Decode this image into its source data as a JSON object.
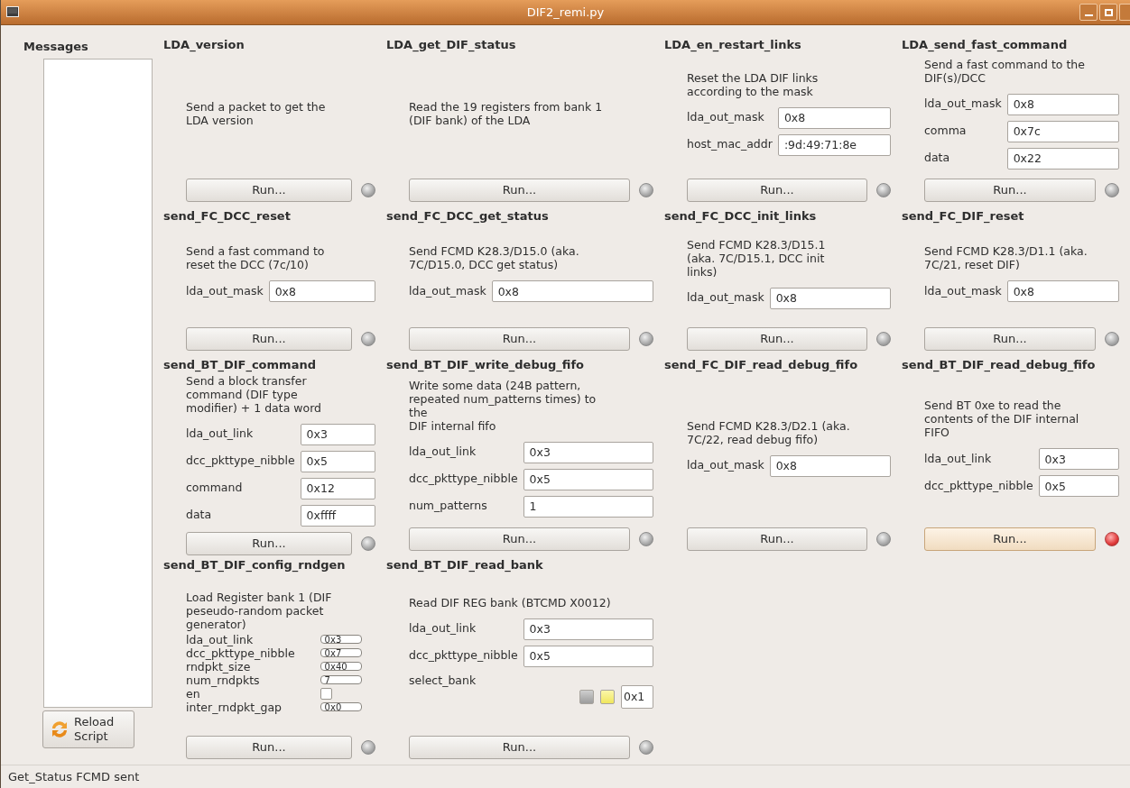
{
  "window": {
    "title": "DIF2_remi.py"
  },
  "sidebar": {
    "heading": "Messages",
    "reload_button": "Reload Script"
  },
  "panels": [
    {
      "title": "LDA_version",
      "description": "Send a packet to get the\nLDA version",
      "button": "Run...",
      "running": false
    },
    {
      "title": "LDA_get_DIF_status",
      "description": "Read the 19 registers from bank 1\n(DIF bank) of the LDA",
      "button": "Run...",
      "running": false
    },
    {
      "title": "LDA_en_restart_links",
      "description": "Reset the LDA DIF links\naccording to the mask",
      "fields": [
        {
          "kind": "text",
          "label": "lda_out_mask",
          "value": "0x8"
        },
        {
          "kind": "text",
          "label": "host_mac_addr",
          "value": ":9d:49:71:8e"
        }
      ],
      "button": "Run...",
      "running": false
    },
    {
      "title": "LDA_send_fast_command",
      "description": "Send a fast command to the\nDIF(s)/DCC",
      "fields": [
        {
          "kind": "text",
          "label": "lda_out_mask",
          "value": "0x8"
        },
        {
          "kind": "text",
          "label": "comma",
          "value": "0x7c"
        },
        {
          "kind": "text",
          "label": "data",
          "value": "0x22"
        }
      ],
      "button": "Run...",
      "running": false
    },
    {
      "title": "send_FC_DCC_reset",
      "description": "Send a fast command to\nreset the DCC (7c/10)",
      "fields": [
        {
          "kind": "text",
          "label": "lda_out_mask",
          "value": "0x8"
        }
      ],
      "button": "Run...",
      "running": false
    },
    {
      "title": "send_FC_DCC_get_status",
      "description": "Send FCMD K28.3/D15.0 (aka.\n7C/D15.0, DCC get status)",
      "fields": [
        {
          "kind": "text",
          "label": "lda_out_mask",
          "value": "0x8"
        }
      ],
      "button": "Run...",
      "running": false
    },
    {
      "title": "send_FC_DCC_init_links",
      "description": "Send FCMD K28.3/D15.1\n(aka. 7C/D15.1, DCC init\nlinks)",
      "fields": [
        {
          "kind": "text",
          "label": "lda_out_mask",
          "value": "0x8"
        }
      ],
      "button": "Run...",
      "running": false
    },
    {
      "title": "send_FC_DIF_reset",
      "description": "Send FCMD K28.3/D1.1 (aka.\n7C/21, reset DIF)",
      "fields": [
        {
          "kind": "text",
          "label": "lda_out_mask",
          "value": "0x8"
        }
      ],
      "button": "Run...",
      "running": false
    },
    {
      "title": "send_BT_DIF_command",
      "description": "Send a block transfer\ncommand (DIF type\nmodifier) + 1 data word",
      "fields": [
        {
          "kind": "text",
          "label": "lda_out_link",
          "value": "0x3"
        },
        {
          "kind": "text",
          "label": "dcc_pkttype_nibble",
          "value": "0x5"
        },
        {
          "kind": "text",
          "label": "command",
          "value": "0x12"
        },
        {
          "kind": "text",
          "label": "data",
          "value": "0xffff"
        }
      ],
      "button": "Run...",
      "running": false
    },
    {
      "title": "send_BT_DIF_write_debug_fifo",
      "description": "Write some data (24B pattern,\nrepeated num_patterns times) to\nthe\nDIF internal fifo",
      "fields": [
        {
          "kind": "text",
          "label": "lda_out_link",
          "value": "0x3"
        },
        {
          "kind": "text",
          "label": "dcc_pkttype_nibble",
          "value": "0x5"
        },
        {
          "kind": "text",
          "label": "num_patterns",
          "value": "1"
        }
      ],
      "button": "Run...",
      "running": false
    },
    {
      "title": "send_FC_DIF_read_debug_fifo",
      "description": "Send FCMD K28.3/D2.1 (aka.\n7C/22, read debug fifo)",
      "fields": [
        {
          "kind": "text",
          "label": "lda_out_mask",
          "value": "0x8"
        }
      ],
      "button": "Run...",
      "running": false
    },
    {
      "title": "send_BT_DIF_read_debug_fifo",
      "description": "Send BT 0xe to read the\ncontents of the DIF internal\nFIFO",
      "fields": [
        {
          "kind": "text",
          "label": "lda_out_link",
          "value": "0x3"
        },
        {
          "kind": "text",
          "label": "dcc_pkttype_nibble",
          "value": "0x5"
        }
      ],
      "button": "Run...",
      "running": true
    },
    {
      "title": "send_BT_DIF_config_rndgen",
      "description": "Load Register bank 1 (DIF\npeseudo-random packet\ngenerator)",
      "compact": true,
      "fields": [
        {
          "kind": "text",
          "label": "lda_out_link",
          "value": "0x3"
        },
        {
          "kind": "text",
          "label": "dcc_pkttype_nibble",
          "value": "0x7"
        },
        {
          "kind": "text",
          "label": "rndpkt_size",
          "value": "0x40"
        },
        {
          "kind": "text",
          "label": "num_rndpkts",
          "value": "7"
        },
        {
          "kind": "checkbox",
          "label": "en",
          "checked": false
        },
        {
          "kind": "text",
          "label": "inter_rndpkt_gap",
          "value": "0x0"
        }
      ],
      "button": "Run...",
      "running": false
    },
    {
      "title": "send_BT_DIF_read_bank",
      "description": "Read DIF REG bank (BTCMD X0012)",
      "fields": [
        {
          "kind": "text",
          "label": "lda_out_link",
          "value": "0x3"
        },
        {
          "kind": "text",
          "label": "dcc_pkttype_nibble",
          "value": "0x5"
        },
        {
          "kind": "bank_select",
          "label": "select_bank",
          "toggles": [
            {
              "on": false
            },
            {
              "on": true
            }
          ],
          "value": "0x1"
        }
      ],
      "button": "Run...",
      "running": false
    }
  ],
  "status_bar": "Get_Status FCMD sent"
}
